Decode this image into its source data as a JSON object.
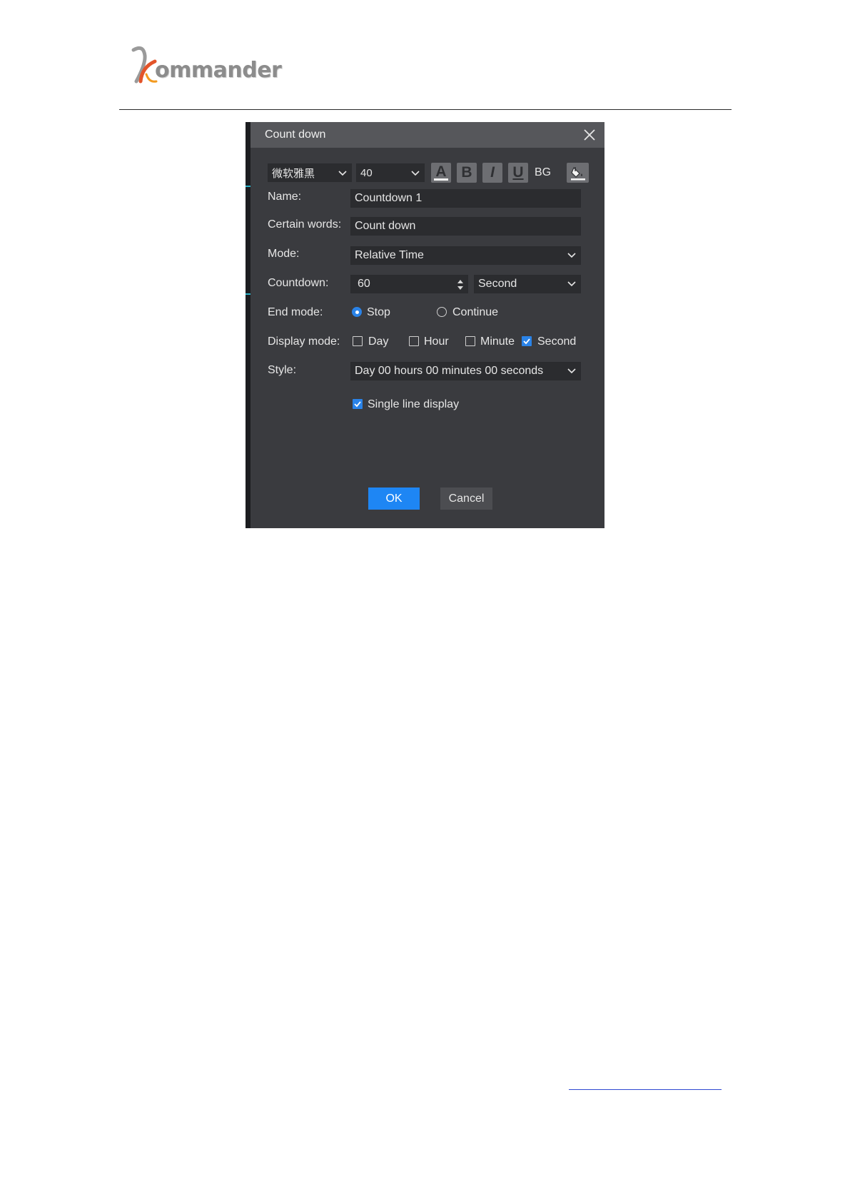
{
  "logo": {
    "text": "ommander"
  },
  "dialog": {
    "title": "Count down",
    "toolbar": {
      "font_name": "微软雅黑",
      "font_size": "40",
      "font_color_letter": "A",
      "bold_letter": "B",
      "italic_letter": "I",
      "underline_letter": "U",
      "bg_label": "BG"
    },
    "name_label": "Name:",
    "name_value": "Countdown 1",
    "words_label": "Certain words:",
    "words_value": "Count down",
    "mode_label": "Mode:",
    "mode_value": "Relative Time",
    "countdown_label": "Countdown:",
    "countdown_value": "60",
    "countdown_unit": "Second",
    "end_mode_label": "End mode:",
    "end_mode_options": [
      {
        "label": "Stop",
        "selected": true
      },
      {
        "label": "Continue",
        "selected": false
      }
    ],
    "display_mode_label": "Display mode:",
    "display_mode_options": [
      {
        "label": "Day",
        "checked": false
      },
      {
        "label": "Hour",
        "checked": false
      },
      {
        "label": "Minute",
        "checked": false
      },
      {
        "label": "Second",
        "checked": true
      }
    ],
    "style_label": "Style:",
    "style_value": "Day 00 hours 00 minutes 00 seconds",
    "single_line_label": "Single line display",
    "single_line_checked": true,
    "ok_label": "OK",
    "cancel_label": "Cancel"
  },
  "colors": {
    "accent": "#1e86f4",
    "dialog_bg": "#3a3b3f",
    "titlebar_bg": "#56575b",
    "input_bg": "#2b2c2f"
  }
}
